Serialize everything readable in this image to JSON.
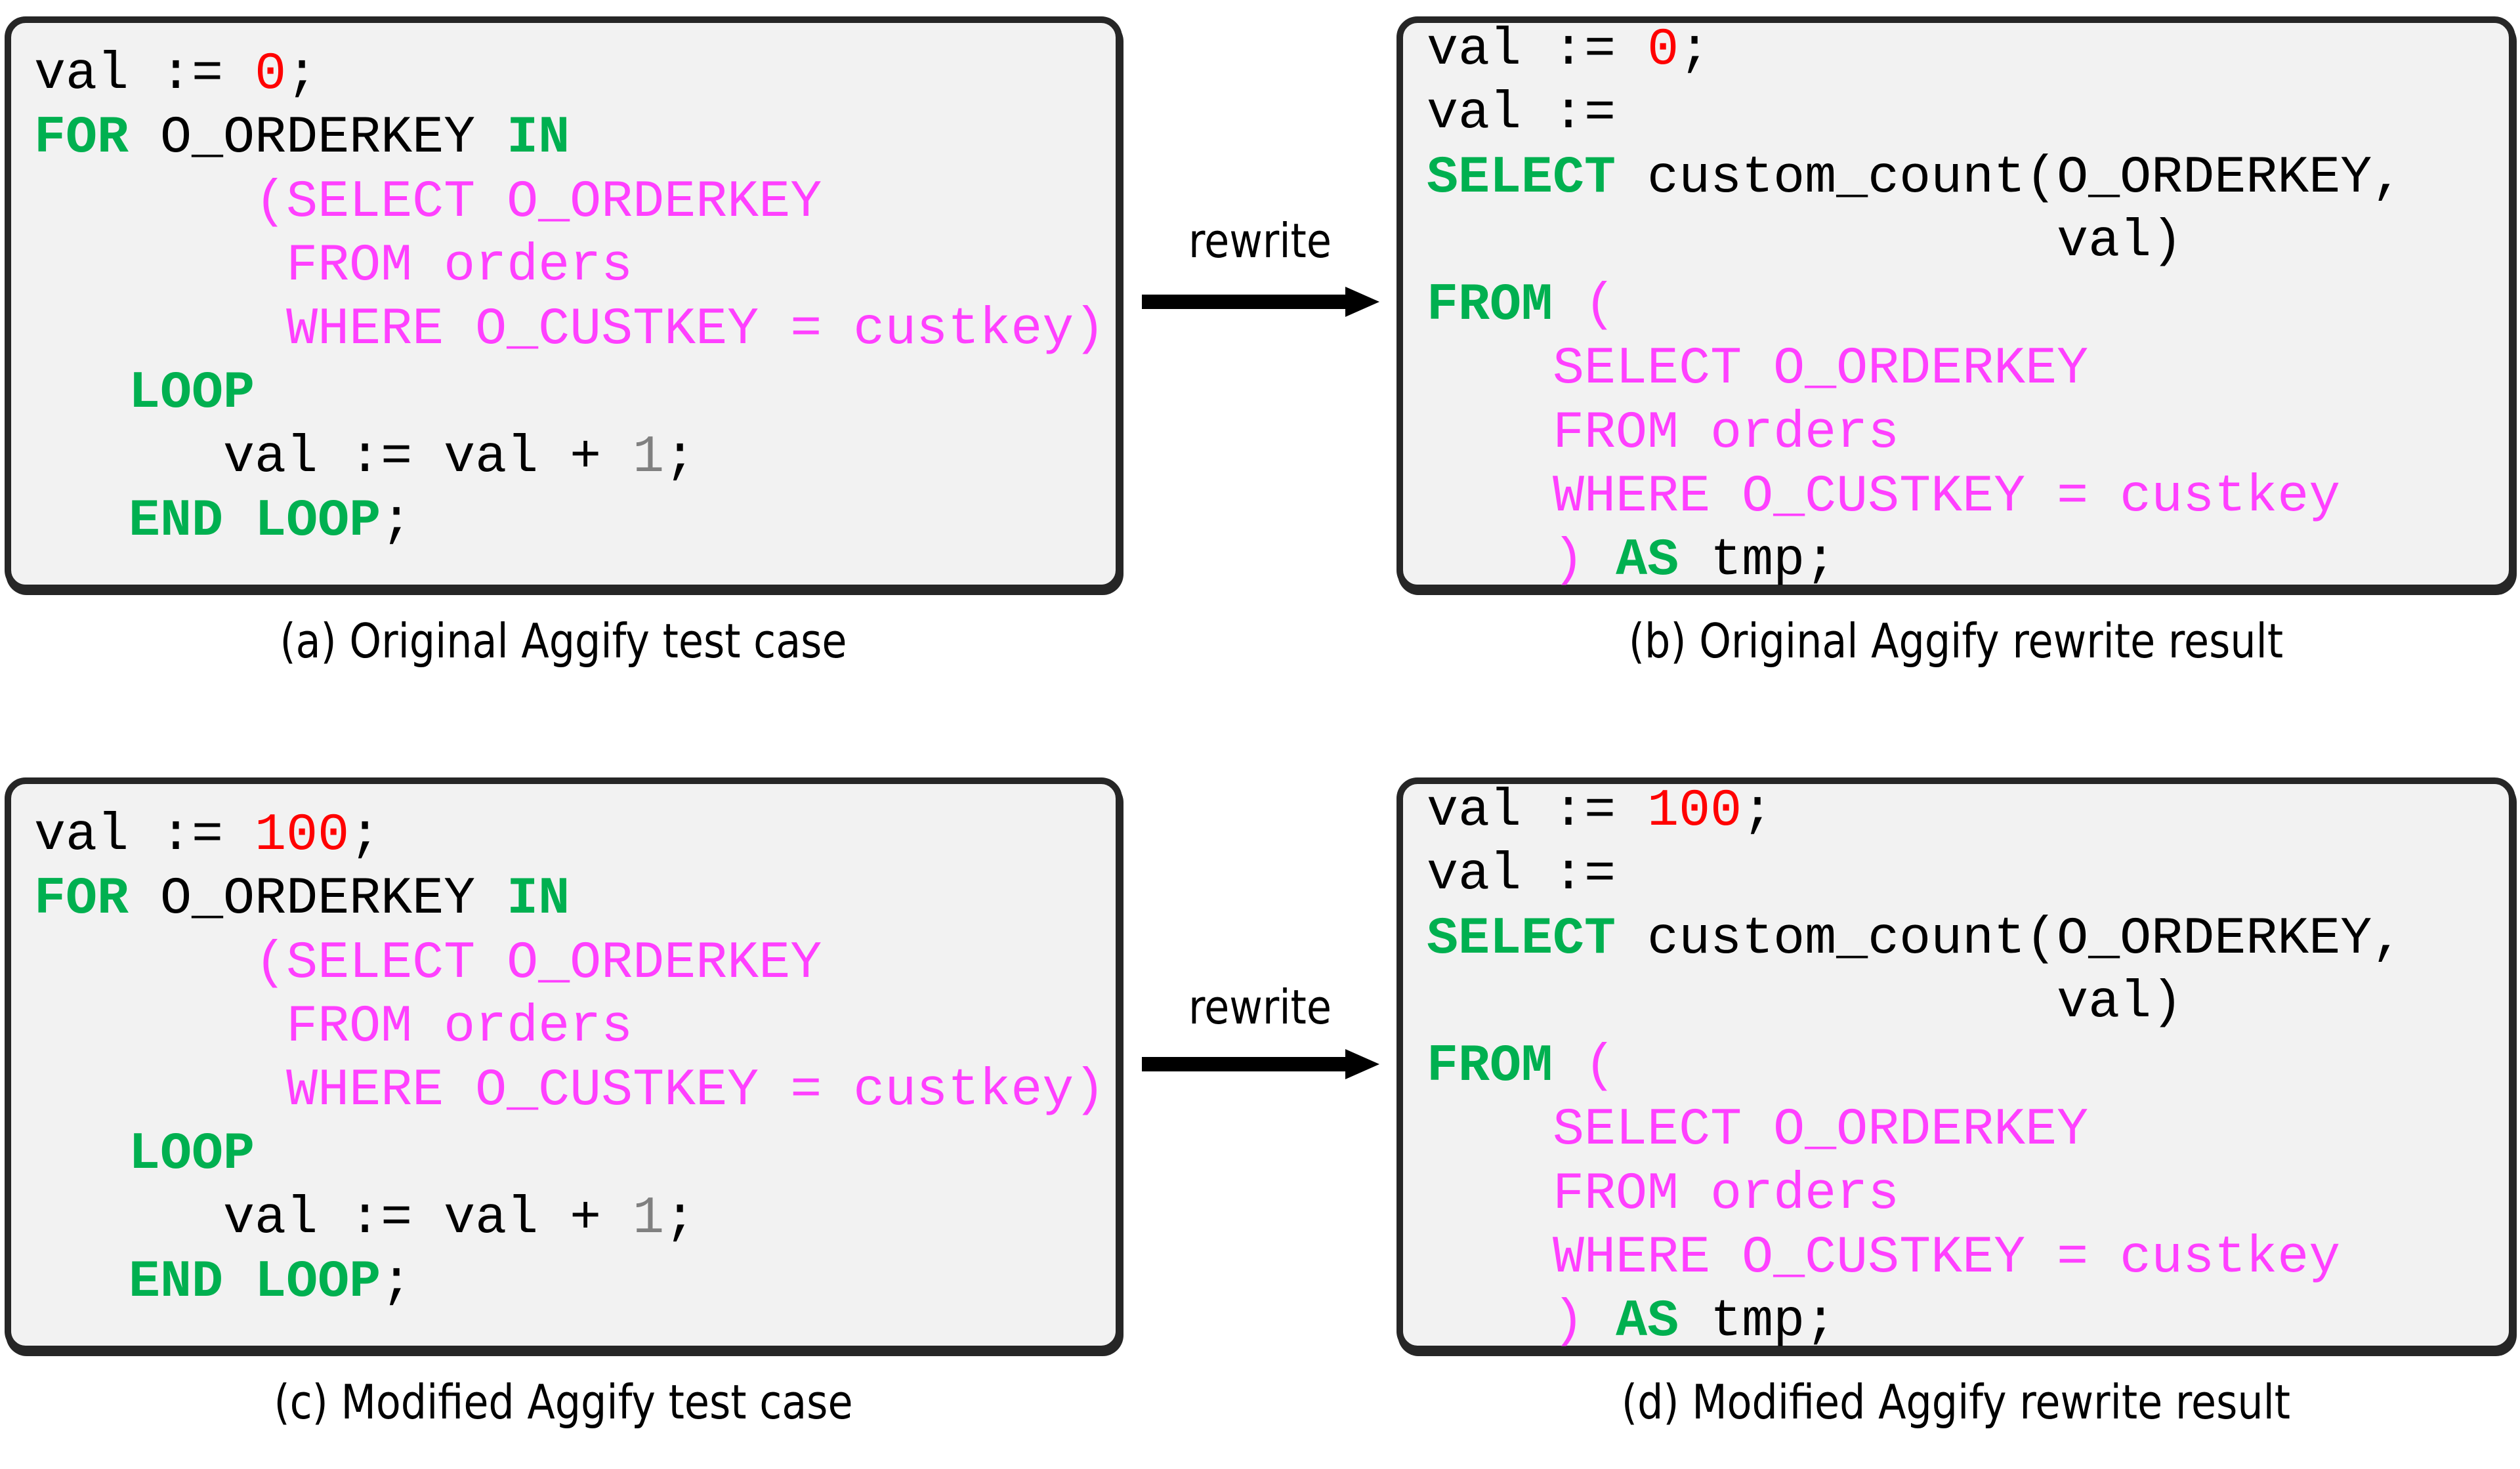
{
  "figure": {
    "arrow_label": "rewrite",
    "colors": {
      "keyword": "#00b050",
      "sql_subquery": "#ff40ff",
      "numeric_literal": "#ff0000",
      "loop_increment": "#808080",
      "panel_background": "#f2f2f2",
      "panel_border": "#262626"
    },
    "panels": {
      "a": {
        "caption": "(a) Original Aggify test case",
        "lines": [
          [
            {
              "t": "val := ",
              "c": "plain"
            },
            {
              "t": "0",
              "c": "num"
            },
            {
              "t": ";",
              "c": "plain"
            }
          ],
          [
            {
              "t": "FOR",
              "c": "kw"
            },
            {
              "t": " O_ORDERKEY ",
              "c": "plain"
            },
            {
              "t": "IN",
              "c": "kw"
            }
          ],
          [
            {
              "t": "       ",
              "c": "plain"
            },
            {
              "t": "(SELECT O_ORDERKEY",
              "c": "sql"
            }
          ],
          [
            {
              "t": "        ",
              "c": "plain"
            },
            {
              "t": "FROM orders",
              "c": "sql"
            }
          ],
          [
            {
              "t": "        ",
              "c": "plain"
            },
            {
              "t": "WHERE O_CUSTKEY = custkey)",
              "c": "sql"
            }
          ],
          [
            {
              "t": "   ",
              "c": "plain"
            },
            {
              "t": "LOOP",
              "c": "kw"
            }
          ],
          [
            {
              "t": "      val := val + ",
              "c": "plain"
            },
            {
              "t": "1",
              "c": "num1"
            },
            {
              "t": ";",
              "c": "plain"
            }
          ],
          [
            {
              "t": "   ",
              "c": "plain"
            },
            {
              "t": "END LOOP",
              "c": "kw"
            },
            {
              "t": ";",
              "c": "plain"
            }
          ]
        ]
      },
      "b": {
        "caption": "(b) Original Aggify rewrite result",
        "lines": [
          [
            {
              "t": "val := ",
              "c": "plain"
            },
            {
              "t": "0",
              "c": "num"
            },
            {
              "t": ";",
              "c": "plain"
            }
          ],
          [
            {
              "t": "val :=",
              "c": "plain"
            }
          ],
          [
            {
              "t": "SELECT",
              "c": "kw"
            },
            {
              "t": " custom_count(O_ORDERKEY,",
              "c": "plain"
            }
          ],
          [
            {
              "t": "                    val)",
              "c": "plain"
            }
          ],
          [
            {
              "t": "FROM",
              "c": "kw"
            },
            {
              "t": " ",
              "c": "plain"
            },
            {
              "t": "(",
              "c": "sql"
            }
          ],
          [
            {
              "t": "    ",
              "c": "plain"
            },
            {
              "t": "SELECT O_ORDERKEY",
              "c": "sql"
            }
          ],
          [
            {
              "t": "    ",
              "c": "plain"
            },
            {
              "t": "FROM orders",
              "c": "sql"
            }
          ],
          [
            {
              "t": "    ",
              "c": "plain"
            },
            {
              "t": "WHERE O_CUSTKEY = custkey",
              "c": "sql"
            }
          ],
          [
            {
              "t": "    ",
              "c": "plain"
            },
            {
              "t": ")",
              "c": "sql"
            },
            {
              "t": " ",
              "c": "plain"
            },
            {
              "t": "AS",
              "c": "kw"
            },
            {
              "t": " tmp;",
              "c": "plain"
            }
          ]
        ]
      },
      "c": {
        "caption": "(c) Modified Aggify test case",
        "lines": [
          [
            {
              "t": "val := ",
              "c": "plain"
            },
            {
              "t": "100",
              "c": "num"
            },
            {
              "t": ";",
              "c": "plain"
            }
          ],
          [
            {
              "t": "FOR",
              "c": "kw"
            },
            {
              "t": " O_ORDERKEY ",
              "c": "plain"
            },
            {
              "t": "IN",
              "c": "kw"
            }
          ],
          [
            {
              "t": "       ",
              "c": "plain"
            },
            {
              "t": "(SELECT O_ORDERKEY",
              "c": "sql"
            }
          ],
          [
            {
              "t": "        ",
              "c": "plain"
            },
            {
              "t": "FROM orders",
              "c": "sql"
            }
          ],
          [
            {
              "t": "        ",
              "c": "plain"
            },
            {
              "t": "WHERE O_CUSTKEY = custkey)",
              "c": "sql"
            }
          ],
          [
            {
              "t": "   ",
              "c": "plain"
            },
            {
              "t": "LOOP",
              "c": "kw"
            }
          ],
          [
            {
              "t": "      val := val + ",
              "c": "plain"
            },
            {
              "t": "1",
              "c": "num1"
            },
            {
              "t": ";",
              "c": "plain"
            }
          ],
          [
            {
              "t": "   ",
              "c": "plain"
            },
            {
              "t": "END LOOP",
              "c": "kw"
            },
            {
              "t": ";",
              "c": "plain"
            }
          ]
        ]
      },
      "d": {
        "caption": "(d) Modified Aggify rewrite result",
        "lines": [
          [
            {
              "t": "val := ",
              "c": "plain"
            },
            {
              "t": "100",
              "c": "num"
            },
            {
              "t": ";",
              "c": "plain"
            }
          ],
          [
            {
              "t": "val :=",
              "c": "plain"
            }
          ],
          [
            {
              "t": "SELECT",
              "c": "kw"
            },
            {
              "t": " custom_count(O_ORDERKEY,",
              "c": "plain"
            }
          ],
          [
            {
              "t": "                    val)",
              "c": "plain"
            }
          ],
          [
            {
              "t": "FROM",
              "c": "kw"
            },
            {
              "t": " ",
              "c": "plain"
            },
            {
              "t": "(",
              "c": "sql"
            }
          ],
          [
            {
              "t": "    ",
              "c": "plain"
            },
            {
              "t": "SELECT O_ORDERKEY",
              "c": "sql"
            }
          ],
          [
            {
              "t": "    ",
              "c": "plain"
            },
            {
              "t": "FROM orders",
              "c": "sql"
            }
          ],
          [
            {
              "t": "    ",
              "c": "plain"
            },
            {
              "t": "WHERE O_CUSTKEY = custkey",
              "c": "sql"
            }
          ],
          [
            {
              "t": "    ",
              "c": "plain"
            },
            {
              "t": ")",
              "c": "sql"
            },
            {
              "t": " ",
              "c": "plain"
            },
            {
              "t": "AS",
              "c": "kw"
            },
            {
              "t": " tmp;",
              "c": "plain"
            }
          ]
        ]
      }
    }
  }
}
